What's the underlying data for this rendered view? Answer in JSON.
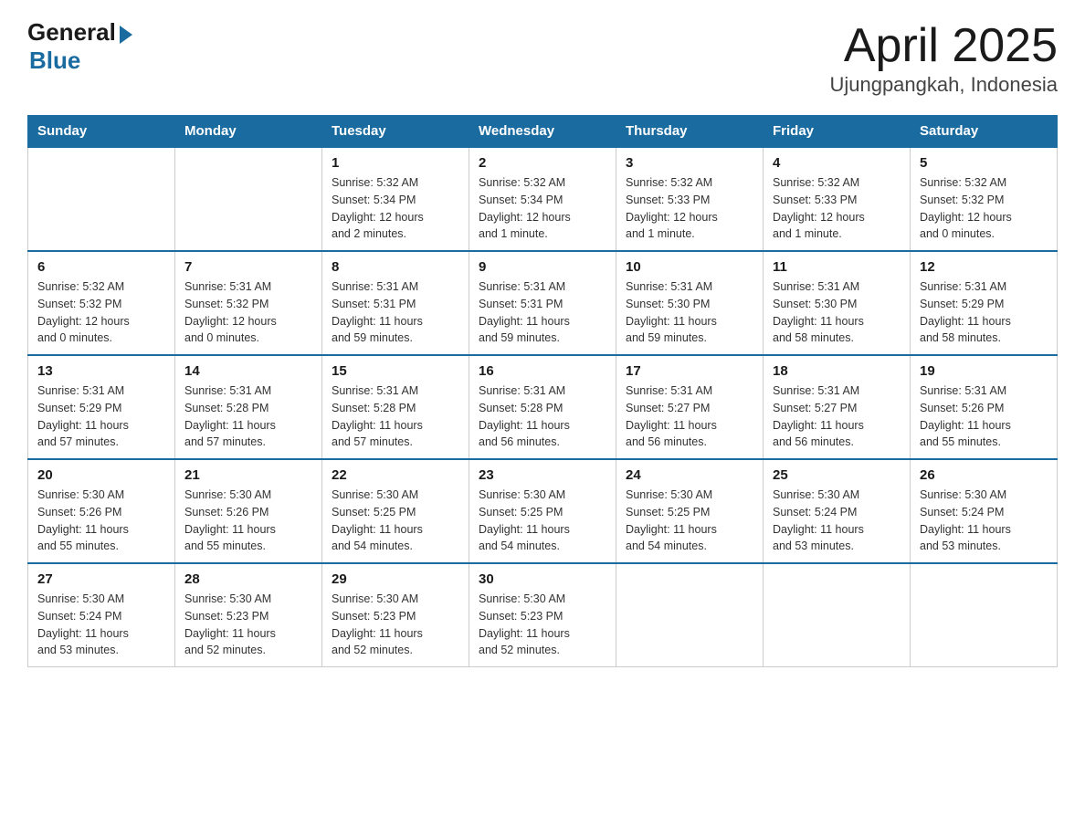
{
  "header": {
    "logo_general": "General",
    "logo_blue": "Blue",
    "month_title": "April 2025",
    "location": "Ujungpangkah, Indonesia"
  },
  "weekdays": [
    "Sunday",
    "Monday",
    "Tuesday",
    "Wednesday",
    "Thursday",
    "Friday",
    "Saturday"
  ],
  "weeks": [
    [
      {
        "day": "",
        "info": ""
      },
      {
        "day": "",
        "info": ""
      },
      {
        "day": "1",
        "info": "Sunrise: 5:32 AM\nSunset: 5:34 PM\nDaylight: 12 hours\nand 2 minutes."
      },
      {
        "day": "2",
        "info": "Sunrise: 5:32 AM\nSunset: 5:34 PM\nDaylight: 12 hours\nand 1 minute."
      },
      {
        "day": "3",
        "info": "Sunrise: 5:32 AM\nSunset: 5:33 PM\nDaylight: 12 hours\nand 1 minute."
      },
      {
        "day": "4",
        "info": "Sunrise: 5:32 AM\nSunset: 5:33 PM\nDaylight: 12 hours\nand 1 minute."
      },
      {
        "day": "5",
        "info": "Sunrise: 5:32 AM\nSunset: 5:32 PM\nDaylight: 12 hours\nand 0 minutes."
      }
    ],
    [
      {
        "day": "6",
        "info": "Sunrise: 5:32 AM\nSunset: 5:32 PM\nDaylight: 12 hours\nand 0 minutes."
      },
      {
        "day": "7",
        "info": "Sunrise: 5:31 AM\nSunset: 5:32 PM\nDaylight: 12 hours\nand 0 minutes."
      },
      {
        "day": "8",
        "info": "Sunrise: 5:31 AM\nSunset: 5:31 PM\nDaylight: 11 hours\nand 59 minutes."
      },
      {
        "day": "9",
        "info": "Sunrise: 5:31 AM\nSunset: 5:31 PM\nDaylight: 11 hours\nand 59 minutes."
      },
      {
        "day": "10",
        "info": "Sunrise: 5:31 AM\nSunset: 5:30 PM\nDaylight: 11 hours\nand 59 minutes."
      },
      {
        "day": "11",
        "info": "Sunrise: 5:31 AM\nSunset: 5:30 PM\nDaylight: 11 hours\nand 58 minutes."
      },
      {
        "day": "12",
        "info": "Sunrise: 5:31 AM\nSunset: 5:29 PM\nDaylight: 11 hours\nand 58 minutes."
      }
    ],
    [
      {
        "day": "13",
        "info": "Sunrise: 5:31 AM\nSunset: 5:29 PM\nDaylight: 11 hours\nand 57 minutes."
      },
      {
        "day": "14",
        "info": "Sunrise: 5:31 AM\nSunset: 5:28 PM\nDaylight: 11 hours\nand 57 minutes."
      },
      {
        "day": "15",
        "info": "Sunrise: 5:31 AM\nSunset: 5:28 PM\nDaylight: 11 hours\nand 57 minutes."
      },
      {
        "day": "16",
        "info": "Sunrise: 5:31 AM\nSunset: 5:28 PM\nDaylight: 11 hours\nand 56 minutes."
      },
      {
        "day": "17",
        "info": "Sunrise: 5:31 AM\nSunset: 5:27 PM\nDaylight: 11 hours\nand 56 minutes."
      },
      {
        "day": "18",
        "info": "Sunrise: 5:31 AM\nSunset: 5:27 PM\nDaylight: 11 hours\nand 56 minutes."
      },
      {
        "day": "19",
        "info": "Sunrise: 5:31 AM\nSunset: 5:26 PM\nDaylight: 11 hours\nand 55 minutes."
      }
    ],
    [
      {
        "day": "20",
        "info": "Sunrise: 5:30 AM\nSunset: 5:26 PM\nDaylight: 11 hours\nand 55 minutes."
      },
      {
        "day": "21",
        "info": "Sunrise: 5:30 AM\nSunset: 5:26 PM\nDaylight: 11 hours\nand 55 minutes."
      },
      {
        "day": "22",
        "info": "Sunrise: 5:30 AM\nSunset: 5:25 PM\nDaylight: 11 hours\nand 54 minutes."
      },
      {
        "day": "23",
        "info": "Sunrise: 5:30 AM\nSunset: 5:25 PM\nDaylight: 11 hours\nand 54 minutes."
      },
      {
        "day": "24",
        "info": "Sunrise: 5:30 AM\nSunset: 5:25 PM\nDaylight: 11 hours\nand 54 minutes."
      },
      {
        "day": "25",
        "info": "Sunrise: 5:30 AM\nSunset: 5:24 PM\nDaylight: 11 hours\nand 53 minutes."
      },
      {
        "day": "26",
        "info": "Sunrise: 5:30 AM\nSunset: 5:24 PM\nDaylight: 11 hours\nand 53 minutes."
      }
    ],
    [
      {
        "day": "27",
        "info": "Sunrise: 5:30 AM\nSunset: 5:24 PM\nDaylight: 11 hours\nand 53 minutes."
      },
      {
        "day": "28",
        "info": "Sunrise: 5:30 AM\nSunset: 5:23 PM\nDaylight: 11 hours\nand 52 minutes."
      },
      {
        "day": "29",
        "info": "Sunrise: 5:30 AM\nSunset: 5:23 PM\nDaylight: 11 hours\nand 52 minutes."
      },
      {
        "day": "30",
        "info": "Sunrise: 5:30 AM\nSunset: 5:23 PM\nDaylight: 11 hours\nand 52 minutes."
      },
      {
        "day": "",
        "info": ""
      },
      {
        "day": "",
        "info": ""
      },
      {
        "day": "",
        "info": ""
      }
    ]
  ]
}
